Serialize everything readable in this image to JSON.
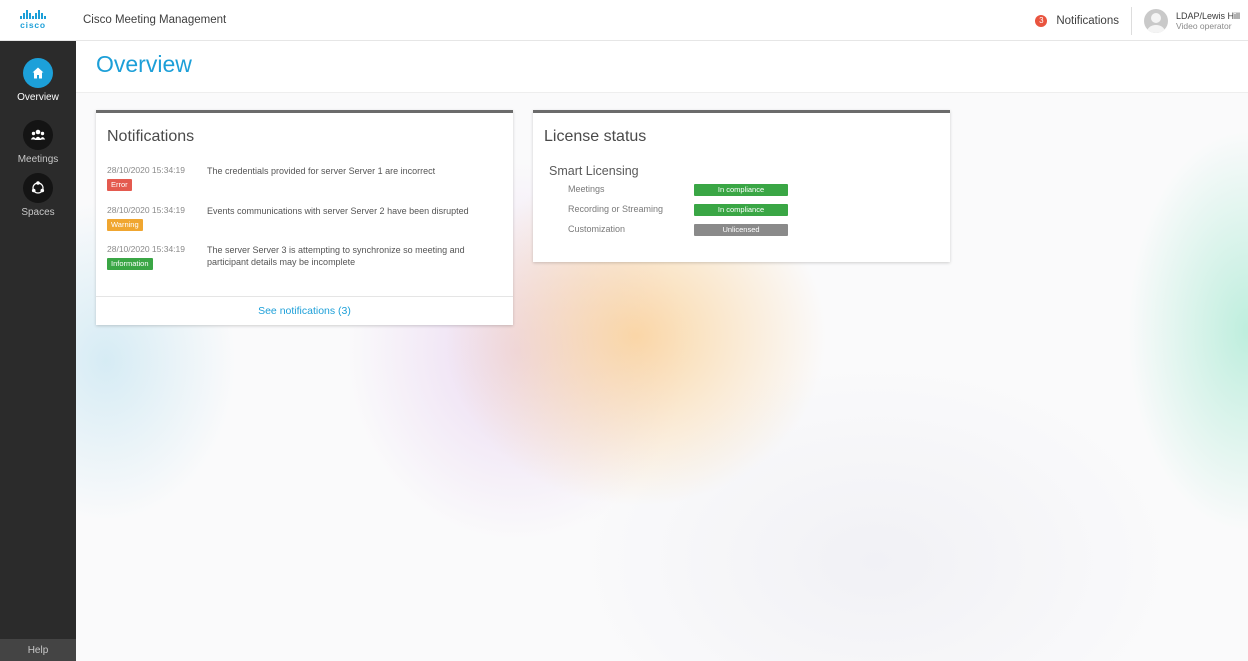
{
  "header": {
    "brand": "cisco",
    "app_title": "Cisco Meeting Management",
    "notifications_count": "3",
    "notifications_label": "Notifications",
    "user_name": "LDAP/Lewis Hill",
    "user_role": "Video operator"
  },
  "sidebar": {
    "items": [
      {
        "label": "Overview",
        "icon": "home-icon",
        "active": true
      },
      {
        "label": "Meetings",
        "icon": "people-icon",
        "active": false
      },
      {
        "label": "Spaces",
        "icon": "spaces-icon",
        "active": false
      }
    ],
    "help_label": "Help"
  },
  "main": {
    "title": "Overview",
    "notifications_card": {
      "title": "Notifications",
      "items": [
        {
          "time": "28/10/2020 15:34:19",
          "level": "Error",
          "message": "The credentials provided for server Server 1 are incorrect"
        },
        {
          "time": "28/10/2020 15:34:19",
          "level": "Warning",
          "message": "Events communications with server Server 2 have been disrupted"
        },
        {
          "time": "28/10/2020 15:34:19",
          "level": "Information",
          "message": "The server Server 3 is attempting to synchronize so meeting and participant details may be incomplete"
        }
      ],
      "footer_link": "See notifications (3)"
    },
    "license_card": {
      "title": "License status",
      "section_title": "Smart Licensing",
      "rows": [
        {
          "label": "Meetings",
          "status": "In compliance"
        },
        {
          "label": "Recording or Streaming",
          "status": "In compliance"
        },
        {
          "label": "Customization",
          "status": "Unlicensed"
        }
      ]
    }
  },
  "colors": {
    "accent": "#1c9fd8",
    "error": "#e45a4f",
    "warning": "#f0a630",
    "information": "#3aa645",
    "compliance": "#3aa645",
    "unlicensed": "#8a8a8a",
    "sidebar": "#2b2b2b"
  }
}
